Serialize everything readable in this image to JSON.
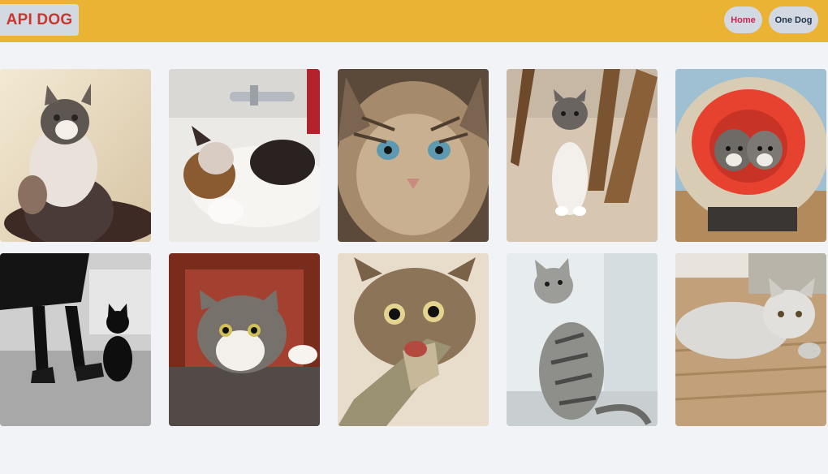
{
  "header": {
    "brand": "API DOG",
    "nav": [
      {
        "label": "Home",
        "color": "#c32650"
      },
      {
        "label": "One Dog",
        "color": "#23344a"
      }
    ],
    "bar_color": "#eab334",
    "pill_color": "#d2d9e2"
  },
  "gallery": {
    "images": [
      {
        "subject": "fluffy grey-and-white kitten sitting on cream blanket"
      },
      {
        "subject": "calico cat sleeping in a white sink under tap"
      },
      {
        "subject": "close-up tabby kitten with blue eyes"
      },
      {
        "subject": "grey and white kitten walking under wooden chair legs"
      },
      {
        "subject": "two grey kittens in red cushion of wicker chair"
      },
      {
        "subject": "black and white photo of legs in heels beside black cat"
      },
      {
        "subject": "grey and white cat peeking inside red wooden cabinet"
      },
      {
        "subject": "tabby kitten biting a fish"
      },
      {
        "subject": "silver spotted tabby kitten looking up by window"
      },
      {
        "subject": "fluffy grey cat lying on a wooden floor"
      }
    ]
  }
}
